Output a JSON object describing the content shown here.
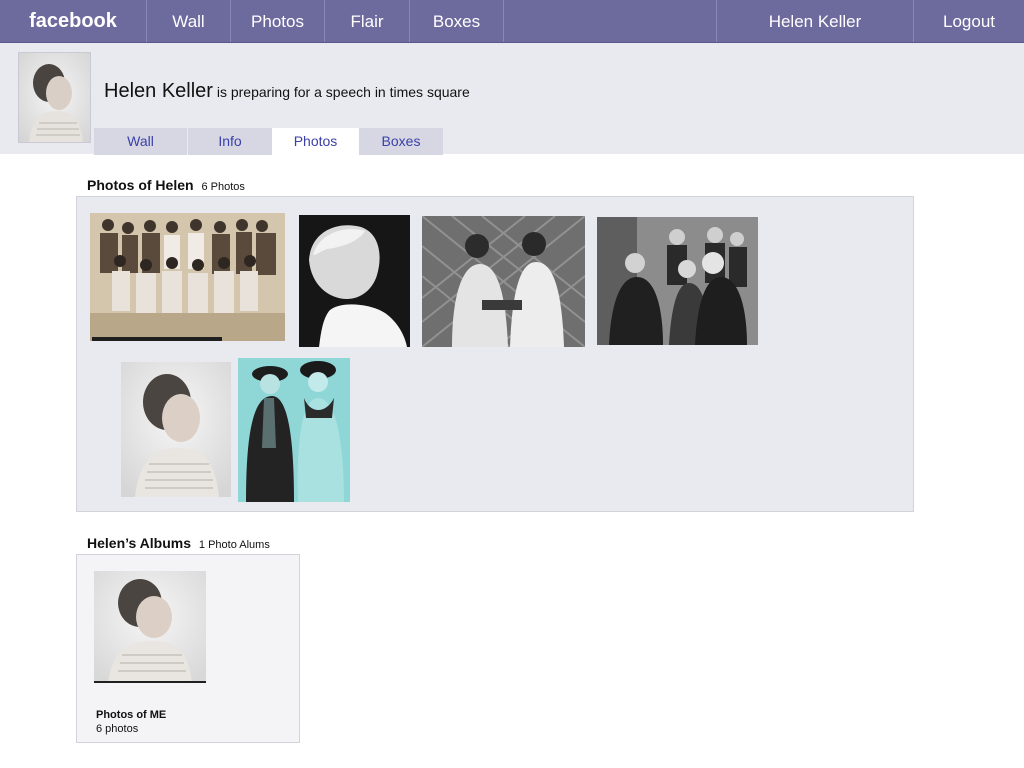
{
  "nav": {
    "brand": "facebook",
    "items": [
      "Wall",
      "Photos",
      "Flair",
      "Boxes"
    ],
    "user": "Helen Keller",
    "logout": "Logout"
  },
  "profile": {
    "name": "Helen Keller",
    "status": "is preparing for a speech in times square",
    "tabs": [
      "Wall",
      "Info",
      "Photos",
      "Boxes"
    ],
    "active_tab": "Photos"
  },
  "photos_section": {
    "title": "Photos of Helen",
    "count": "6 Photos",
    "photos": [
      {
        "icon": "family-group-photo"
      },
      {
        "icon": "child-portrait-photo"
      },
      {
        "icon": "two-women-seated-photo"
      },
      {
        "icon": "group-meeting-photo"
      },
      {
        "icon": "helen-portrait-photo"
      },
      {
        "icon": "two-women-hats-photo"
      }
    ]
  },
  "albums_section": {
    "title": "Helen’s Albums",
    "count": "1 Photo Alums",
    "albums": [
      {
        "name": "Photos of  ME",
        "count": "6 photos",
        "icon": "helen-portrait-photo"
      }
    ]
  },
  "colors": {
    "nav_bg": "#6d6a9e",
    "header_bg": "#e9eaf0",
    "link": "#3b3fa8"
  }
}
